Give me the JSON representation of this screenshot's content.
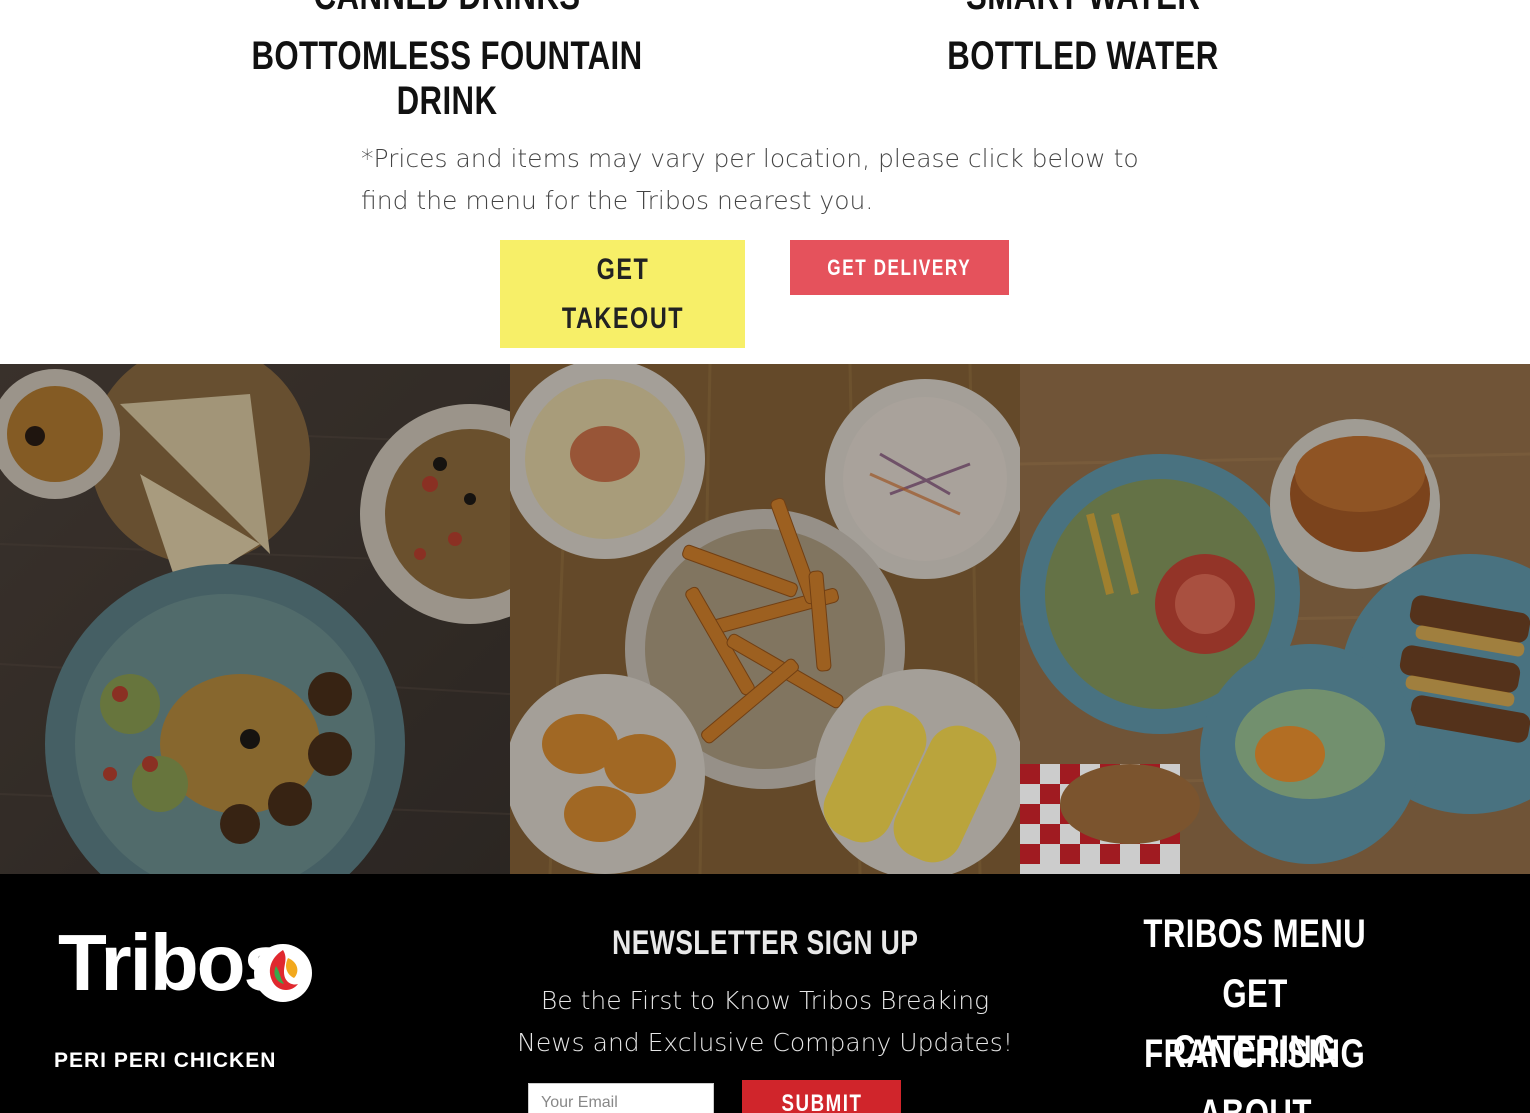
{
  "drinks": {
    "left": [
      "Canned Drinks",
      "Bottomless Fountain Drink"
    ],
    "right": [
      "Smart Water",
      "Bottled Water"
    ]
  },
  "disclaimer": "*Prices and items may vary per location, please click below to find the menu for the Tribos nearest you.",
  "buttons": {
    "takeout": "Get Takeout",
    "delivery": "Get Delivery"
  },
  "photos": [
    {
      "icon": "hummus-falafel-photo"
    },
    {
      "icon": "fries-sides-photo"
    },
    {
      "icon": "chicken-wraps-photo"
    }
  ],
  "footer": {
    "logo_word": "Tribos",
    "logo_tagline": "PERI PERI CHICKEN",
    "newsletter_title": "Newsletter Sign Up",
    "newsletter_text": "Be the First to Know Tribos Breaking News and Exclusive Company Updates!",
    "email_placeholder": "Your Email",
    "submit_label": "Submit",
    "nav": [
      "Tribos Menu",
      "Get Catering",
      "Franchising",
      "About"
    ]
  },
  "colors": {
    "takeout_bg": "#f7ef68",
    "delivery_bg": "#e5525c",
    "submit_bg": "#d0252b",
    "footer_bg": "#000000"
  }
}
